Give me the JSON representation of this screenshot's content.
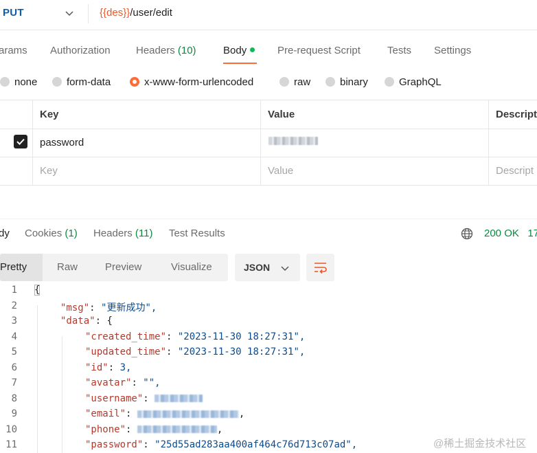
{
  "request": {
    "method": "PUT",
    "url_var": "{{des}}",
    "url_path": "/user/edit"
  },
  "request_tabs": [
    {
      "label": "arams"
    },
    {
      "label": "Authorization"
    },
    {
      "label": "Headers ",
      "count": "(10)"
    },
    {
      "label": "Body"
    },
    {
      "label": "Pre-request Script"
    },
    {
      "label": "Tests"
    },
    {
      "label": "Settings"
    }
  ],
  "body_types": [
    {
      "label": "none"
    },
    {
      "label": "form-data"
    },
    {
      "label": "x-www-form-urlencoded",
      "selected": true
    },
    {
      "label": "raw"
    },
    {
      "label": "binary"
    },
    {
      "label": "GraphQL"
    }
  ],
  "params_table": {
    "headers": [
      "Key",
      "Value",
      "Descript"
    ],
    "rows": [
      {
        "checked": true,
        "key": "password",
        "value_blurred": true
      }
    ],
    "placeholder": {
      "key": "Key",
      "value": "Value",
      "description": "Descript"
    }
  },
  "response_tabs": [
    {
      "label": "dy"
    },
    {
      "label": "Cookies ",
      "count": "(1)"
    },
    {
      "label": "Headers ",
      "count": "(11)"
    },
    {
      "label": "Test Results"
    }
  ],
  "response_status": {
    "code": "200 OK",
    "extra": "17"
  },
  "view_modes": [
    "Pretty",
    "Raw",
    "Preview",
    "Visualize"
  ],
  "format": "JSON",
  "code_lines": [
    {
      "n": "1"
    },
    {
      "n": "2",
      "key": "\"msg\"",
      "val": "\"更新成功\","
    },
    {
      "n": "3",
      "key": "\"data\"",
      "val": "{"
    },
    {
      "n": "4",
      "key": "\"created_time\"",
      "val": "\"2023-11-30 18:27:31\","
    },
    {
      "n": "5",
      "key": "\"updated_time\"",
      "val": "\"2023-11-30 18:27:31\","
    },
    {
      "n": "6",
      "key": "\"id\"",
      "val": "3,"
    },
    {
      "n": "7",
      "key": "\"avatar\"",
      "val": "\"\","
    },
    {
      "n": "8",
      "key": "\"username\""
    },
    {
      "n": "9",
      "key": "\"email\""
    },
    {
      "n": "10",
      "key": "\"phone\""
    },
    {
      "n": "11",
      "key": "\"password\"",
      "val": "\"25d55ad283aa400af464c76d713c07ad\","
    }
  ],
  "watermark": "@稀土掘金技术社区"
}
